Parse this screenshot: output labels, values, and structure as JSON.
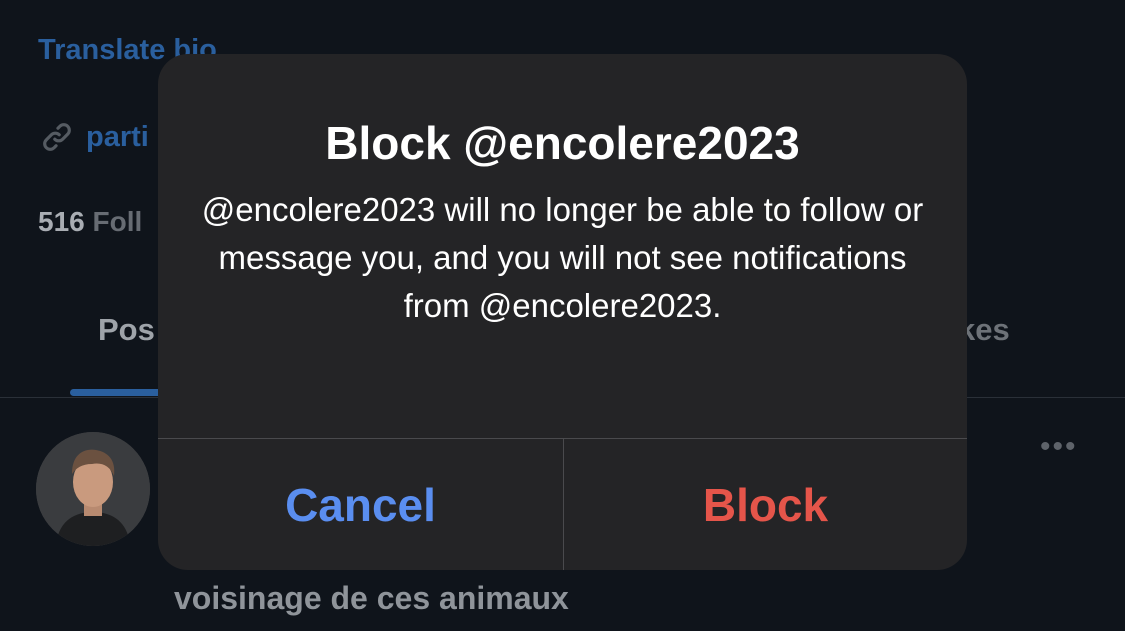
{
  "background": {
    "translate_bio": "Translate bio",
    "link_text": "parti",
    "followers_count": "516",
    "followers_label": "Foll",
    "tab_posts": "Pos",
    "tab_likes": "kes",
    "post_text": "voisinage de ces animaux",
    "more_icon": "more-horizontal-icon"
  },
  "alert": {
    "title": "Block @encolere2023",
    "message": "@encolere2023 will no longer be able to follow or message you, and you will not see notifications from @encolere2023.",
    "cancel_label": "Cancel",
    "block_label": "Block"
  },
  "colors": {
    "cancel": "#5a8ef0",
    "block": "#e5554a",
    "accent": "#2a5f9e"
  }
}
